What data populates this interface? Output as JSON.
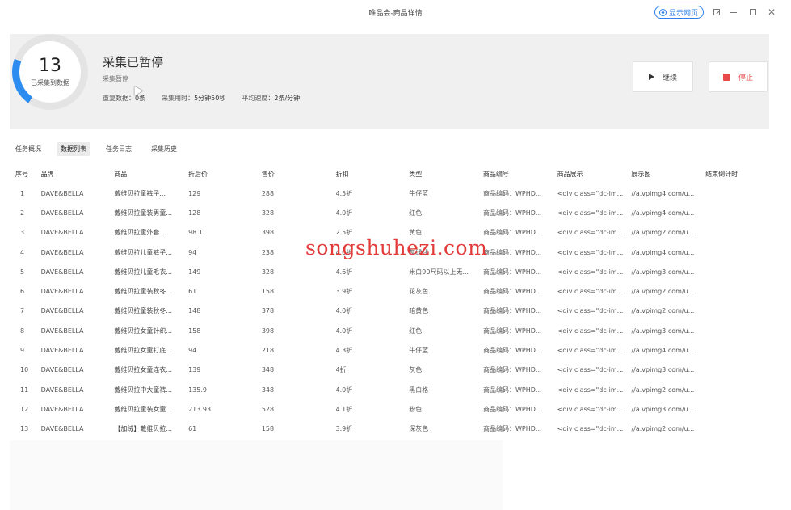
{
  "window": {
    "title": "唯品会-商品详情",
    "show_web_label": "显示网页"
  },
  "header": {
    "collected_count": "13",
    "collected_label": "已采集到数据",
    "status_title": "采集已暂停",
    "status_sub": "采集暂停",
    "duplicate_label": "重复数据：",
    "duplicate_value": "0条",
    "time_label": "采集用时：",
    "time_value": "5分钟50秒",
    "speed_label": "平均速度：",
    "speed_value": "2条/分钟",
    "continue_label": "继续",
    "stop_label": "停止",
    "accent_color": "#2d8cf0",
    "stop_color": "#e84a4a"
  },
  "tabs": [
    {
      "label": "任务概况"
    },
    {
      "label": "数据列表"
    },
    {
      "label": "任务日志"
    },
    {
      "label": "采集历史"
    }
  ],
  "table": {
    "columns": [
      "序号",
      "品牌",
      "商品",
      "折后价",
      "售价",
      "折扣",
      "类型",
      "商品编号",
      "商品展示",
      "展示图",
      "结束倒计时"
    ],
    "rows": [
      [
        "1",
        "DAVE&BELLA",
        "戴维贝拉童裤子...",
        "129",
        "288",
        "4.5折",
        "牛仔蓝",
        "商品编码：WPHD...",
        "<div class=\"dc-im...",
        "//a.vpimg4.com/u...",
        ""
      ],
      [
        "2",
        "DAVE&BELLA",
        "戴维贝拉童装男童...",
        "128",
        "328",
        "4.0折",
        "红色",
        "商品编码：WPHD...",
        "<div class=\"dc-im...",
        "//a.vpimg4.com/u...",
        ""
      ],
      [
        "3",
        "DAVE&BELLA",
        "戴维贝拉童外套...",
        "98.1",
        "398",
        "2.5折",
        "黄色",
        "商品编码：WPHD...",
        "<div class=\"dc-im...",
        "//a.vpimg2.com/u...",
        ""
      ],
      [
        "4",
        "DAVE&BELLA",
        "戴维贝拉儿童裤子...",
        "94",
        "238",
        "4.0折",
        "灰绿线",
        "商品编码：WPHD...",
        "<div class=\"dc-im...",
        "//a.vpimg4.com/u...",
        ""
      ],
      [
        "5",
        "DAVE&BELLA",
        "戴维贝拉儿童毛衣...",
        "149",
        "328",
        "4.6折",
        "米白90尺码以上无...",
        "商品编码：WPHD...",
        "<div class=\"dc-im...",
        "//a.vpimg3.com/u...",
        ""
      ],
      [
        "6",
        "DAVE&BELLA",
        "戴维贝拉童装秋冬...",
        "61",
        "158",
        "3.9折",
        "花灰色",
        "商品编码：WPHD...",
        "<div class=\"dc-im...",
        "//a.vpimg2.com/u...",
        ""
      ],
      [
        "7",
        "DAVE&BELLA",
        "戴维贝拉童装秋冬...",
        "148",
        "378",
        "4.0折",
        "暗黄色",
        "商品编码：WPHD...",
        "<div class=\"dc-im...",
        "//a.vpimg2.com/u...",
        ""
      ],
      [
        "8",
        "DAVE&BELLA",
        "戴维贝拉女童针织...",
        "158",
        "398",
        "4.0折",
        "红色",
        "商品编码：WPHD...",
        "<div class=\"dc-im...",
        "//a.vpimg3.com/u...",
        ""
      ],
      [
        "9",
        "DAVE&BELLA",
        "戴维贝拉女童打底...",
        "94",
        "218",
        "4.3折",
        "牛仔蓝",
        "商品编码：WPHD...",
        "<div class=\"dc-im...",
        "//a.vpimg4.com/u...",
        ""
      ],
      [
        "10",
        "DAVE&BELLA",
        "戴维贝拉女童连衣...",
        "139",
        "348",
        "4折",
        "灰色",
        "商品编码：WPHD...",
        "<div class=\"dc-im...",
        "//a.vpimg3.com/u...",
        ""
      ],
      [
        "11",
        "DAVE&BELLA",
        "戴维贝拉中大童裤...",
        "135.9",
        "348",
        "4.0折",
        "黑白格",
        "商品编码：WPHD...",
        "<div class=\"dc-im...",
        "//a.vpimg2.com/u...",
        ""
      ],
      [
        "12",
        "DAVE&BELLA",
        "戴维贝拉童装女童...",
        "213.93",
        "528",
        "4.1折",
        "粉色",
        "商品编码：WPHD...",
        "<div class=\"dc-im...",
        "//a.vpimg3.com/u...",
        ""
      ],
      [
        "13",
        "DAVE&BELLA",
        "【加绒】戴维贝拉...",
        "61",
        "158",
        "3.9折",
        "深灰色",
        "商品编码：WPHD...",
        "<div class=\"dc-im...",
        "//a.vpimg2.com/u...",
        ""
      ]
    ]
  },
  "watermark": "songshuhezi.com"
}
